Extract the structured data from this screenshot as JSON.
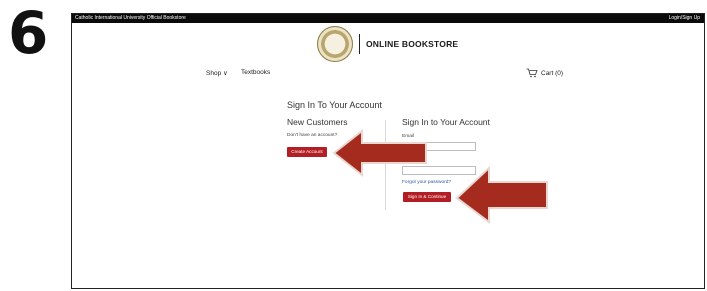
{
  "step": {
    "number": "6"
  },
  "topbar": {
    "left_text": "Catholic International University Official Bookstore",
    "right_text": "Login/Sign Up"
  },
  "header": {
    "brand": "ONLINE BOOKSTORE",
    "logo_icon": "university-seal-icon"
  },
  "nav": {
    "shop_label": "Shop ∨",
    "textbooks_label": "Textbooks",
    "cart_label": "Cart (0)",
    "cart_icon": "shopping-cart-icon"
  },
  "page": {
    "title": "Sign In To Your Account"
  },
  "new_customers": {
    "heading": "New Customers",
    "prompt": "Don't have an account?",
    "create_button": "Create Account"
  },
  "sign_in": {
    "heading": "Sign In to Your Account",
    "email_label": "Email",
    "email_value": "",
    "password_label": "Password",
    "password_value": "",
    "forgot_link": "Forgot your password?",
    "submit_button": "Sign In & Continue"
  },
  "annotations": {
    "arrow_color": "#a62b1f",
    "arrow_icon": "pointer-arrow-icon"
  },
  "colors": {
    "accent": "#b21e23",
    "link": "#2b59a8",
    "topbar": "#0a0a0a"
  }
}
